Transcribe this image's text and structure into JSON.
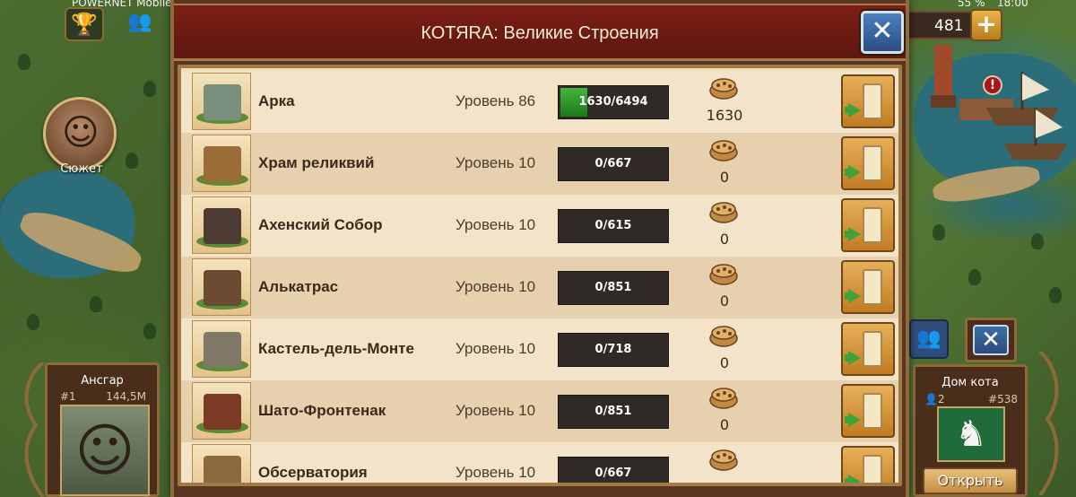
{
  "status_bar": {
    "carrier": "POWERNET Mobile",
    "battery": "55 %",
    "clock": "18:00"
  },
  "hud": {
    "story_label": "Сюжет",
    "coins": "481",
    "alert": "!",
    "player": {
      "name": "Ансгар",
      "rank": "#1",
      "score": "144,5M"
    },
    "guild": {
      "name": "Дом кота",
      "members": "2",
      "rank": "#538",
      "open_label": "Открыть"
    }
  },
  "modal": {
    "title": "КОТЯRA: Великие Строения",
    "close_label": "✕",
    "rows": [
      {
        "name": "Арка",
        "level": "Уровень 86",
        "progress_text": "1630/6494",
        "progress": 0.251,
        "fp": "1630",
        "color": "#7a8e7e"
      },
      {
        "name": "Храм реликвий",
        "level": "Уровень 10",
        "progress_text": "0/667",
        "progress": 0,
        "fp": "0",
        "color": "#9a6c38"
      },
      {
        "name": "Ахенский Собор",
        "level": "Уровень 10",
        "progress_text": "0/615",
        "progress": 0,
        "fp": "0",
        "color": "#4b3b33"
      },
      {
        "name": "Алькатрас",
        "level": "Уровень 10",
        "progress_text": "0/851",
        "progress": 0,
        "fp": "0",
        "color": "#6b4a32"
      },
      {
        "name": "Кастель-дель-Монте",
        "level": "Уровень 10",
        "progress_text": "0/718",
        "progress": 0,
        "fp": "0",
        "color": "#7d7966"
      },
      {
        "name": "Шато-Фронтенак",
        "level": "Уровень 10",
        "progress_text": "0/851",
        "progress": 0,
        "fp": "0",
        "color": "#7a3a24"
      },
      {
        "name": "Обсерватория",
        "level": "Уровень 10",
        "progress_text": "0/667",
        "progress": 0,
        "fp": "",
        "color": "#8b6a3f"
      }
    ]
  },
  "colors": {
    "header_red": "#7c1f16",
    "panel_beige": "#efdcbe",
    "progress_green": "#43b53a",
    "button_gold": "#e6b05a"
  }
}
